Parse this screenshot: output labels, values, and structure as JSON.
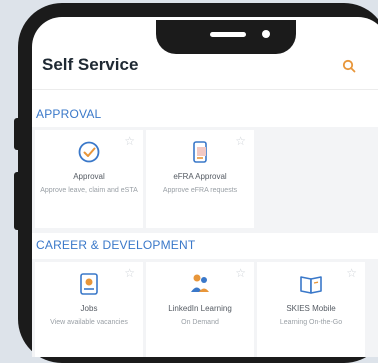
{
  "header": {
    "title": "Self Service",
    "search_icon": "search-icon"
  },
  "sections": [
    {
      "label": "APPROVAL",
      "tiles": [
        {
          "name": "Approval",
          "description": "Approve leave, claim and eSTA",
          "icon": "check-circle-icon"
        },
        {
          "name": "eFRA Approval",
          "description": "Approve eFRA requests",
          "icon": "document-phone-icon"
        }
      ]
    },
    {
      "label": "CAREER & DEVELOPMENT",
      "tiles": [
        {
          "name": "Jobs",
          "description": "View available vacancies",
          "icon": "id-card-icon"
        },
        {
          "name": "LinkedIn Learning",
          "description": "On Demand",
          "icon": "people-icon"
        },
        {
          "name": "SKIES Mobile",
          "description": "Learning On-the-Go",
          "icon": "book-icon"
        }
      ]
    }
  ],
  "colors": {
    "accent": "#3a78c9",
    "search": "#e8963a",
    "bezel": "#1b1b1b"
  }
}
